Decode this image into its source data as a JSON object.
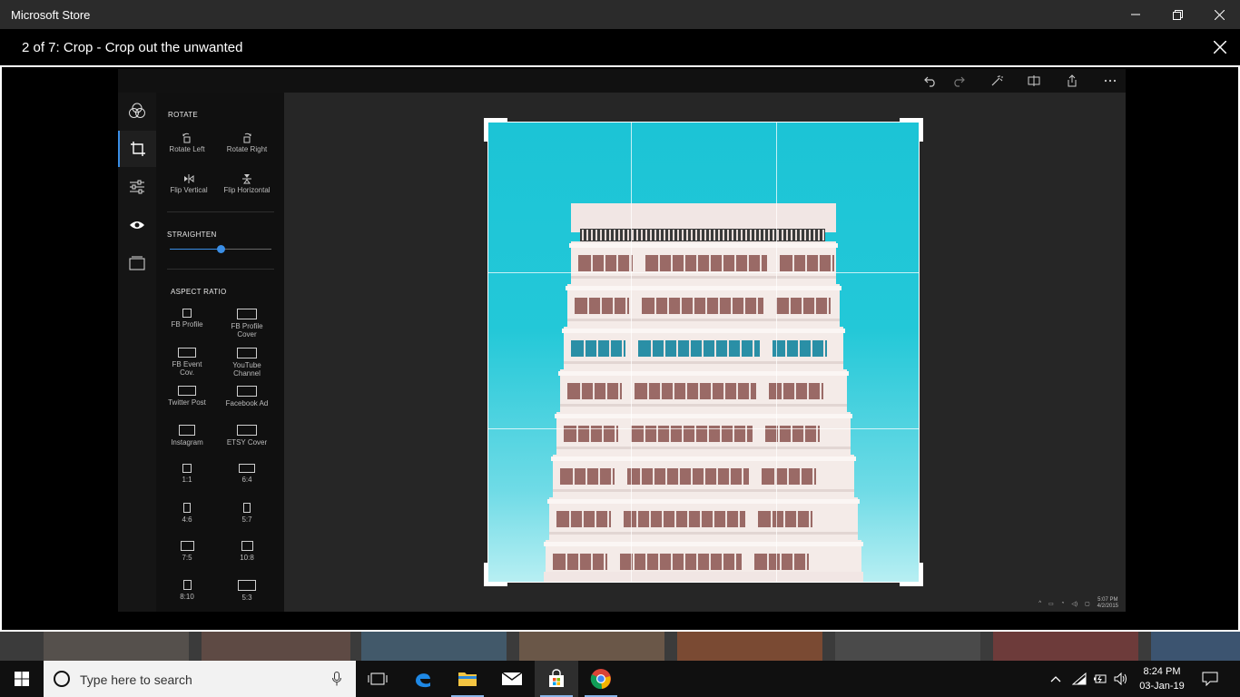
{
  "window": {
    "title": "Microsoft Store",
    "minimize_icon": "minimize-icon",
    "maximize_icon": "restore-icon",
    "close_icon": "close-icon"
  },
  "viewer": {
    "caption": "2 of 7: Crop - Crop out the unwanted",
    "close_icon": "close-icon"
  },
  "editor": {
    "toolbar_icons": [
      "undo-icon",
      "redo-icon",
      "magic-wand-icon",
      "compare-icon",
      "share-icon",
      "more-icon"
    ],
    "rail": [
      "filters-icon",
      "crop-icon",
      "adjustments-icon",
      "eye-icon",
      "borders-icon"
    ],
    "rail_active": "crop-icon",
    "rotate": {
      "title": "ROTATE",
      "rotate_left": "Rotate Left",
      "rotate_right": "Rotate Right",
      "flip_vertical": "Flip Vertical",
      "flip_horizontal": "Flip Horizontal"
    },
    "straighten": {
      "title": "STRAIGHTEN",
      "value": 0.5
    },
    "aspect_ratio": {
      "title": "ASPECT RATIO",
      "options": [
        {
          "label": "FB Profile",
          "label2": ""
        },
        {
          "label": "FB Profile",
          "label2": "Cover"
        },
        {
          "label": "FB Event",
          "label2": "Cov."
        },
        {
          "label": "YouTube",
          "label2": "Channel"
        },
        {
          "label": "Twitter Post",
          "label2": ""
        },
        {
          "label": "Facebook Ad",
          "label2": ""
        },
        {
          "label": "Instagram",
          "label2": ""
        },
        {
          "label": "ETSY Cover",
          "label2": ""
        },
        {
          "label": "1:1",
          "label2": ""
        },
        {
          "label": "6:4",
          "label2": ""
        },
        {
          "label": "4:6",
          "label2": ""
        },
        {
          "label": "5:7",
          "label2": ""
        },
        {
          "label": "7:5",
          "label2": ""
        },
        {
          "label": "10:8",
          "label2": ""
        },
        {
          "label": "8:10",
          "label2": ""
        },
        {
          "label": "5:3",
          "label2": ""
        }
      ]
    },
    "status": {
      "time": "5:07 PM",
      "date": "4/2/2015"
    }
  },
  "colors": {
    "accent": "#3a8ee6",
    "sky": "#1cc4d6"
  },
  "taskbar": {
    "search_placeholder": "Type here to search",
    "apps": [
      "task-view-icon",
      "edge-icon",
      "file-explorer-icon",
      "mail-icon",
      "store-icon",
      "chrome-icon"
    ],
    "clock_time": "8:24 PM",
    "clock_date": "03-Jan-19"
  }
}
